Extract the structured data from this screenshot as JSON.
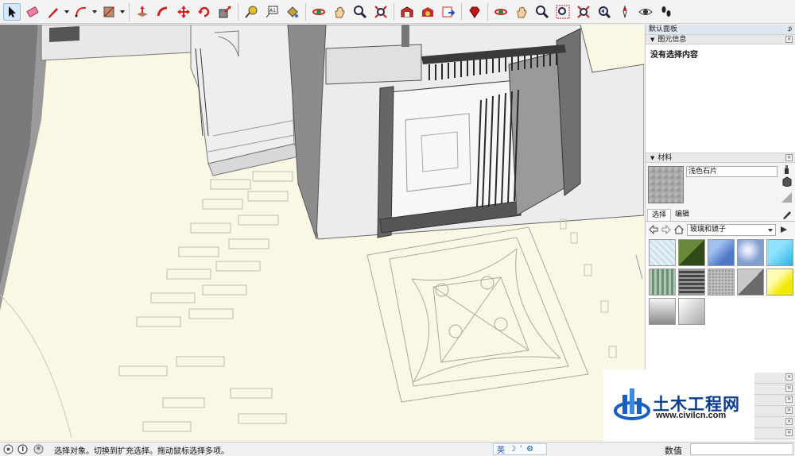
{
  "toolbar": {
    "tools": [
      "select-tool",
      "eraser-tool",
      "pencil-tool",
      "arc-tool",
      "shape-tool",
      "push-pull-tool",
      "follow-me-tool",
      "move-tool",
      "rotate-tool",
      "scale-tool",
      "tape-measure-tool",
      "text-tool",
      "paint-bucket-tool",
      "orbit-tool",
      "pan-tool",
      "zoom-tool",
      "zoom-extents-tool",
      "warehouse-tool",
      "extension-warehouse-tool",
      "send-to-layout-tool",
      "ruby-tool",
      "orbit-tool-2",
      "pan-tool-2",
      "zoom-tool-2",
      "zoom-window-tool",
      "zoom-extents-tool-2",
      "previous-view-tool",
      "position-camera-tool",
      "look-around-tool",
      "walk-tool"
    ],
    "text_tool_label": "A1"
  },
  "panel": {
    "title": "默认面板",
    "entity_info": {
      "header": "图元信息",
      "content": "没有选择内容"
    },
    "materials": {
      "header": "材料",
      "material_name": "浅色石片",
      "tabs": [
        "选择",
        "编辑"
      ],
      "library": "玻璃和镜子",
      "swatch_colors": [
        "#cfe3ef",
        "#5a7a30",
        "#6f98d8",
        "#7f9fcf",
        "#5cc8ef",
        "#8fae98",
        "#6a6a6a",
        "#bdbdbd",
        "#8c8c8c",
        "#f7f021",
        "#c8c8c8",
        "#e2e2e2"
      ]
    }
  },
  "statusbar": {
    "message": "选择对象。切换到扩充选择。拖动鼠标选择多项。",
    "ime_label": "英",
    "measure_label": "数值"
  },
  "watermark": {
    "title": "土木工程网",
    "url": "www.civilcn.com"
  }
}
